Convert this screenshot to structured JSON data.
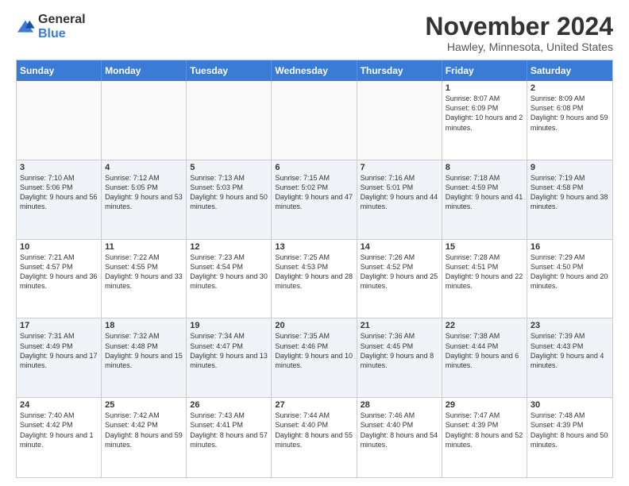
{
  "header": {
    "logo_general": "General",
    "logo_blue": "Blue",
    "main_title": "November 2024",
    "subtitle": "Hawley, Minnesota, United States"
  },
  "calendar": {
    "days_of_week": [
      "Sunday",
      "Monday",
      "Tuesday",
      "Wednesday",
      "Thursday",
      "Friday",
      "Saturday"
    ],
    "weeks": [
      {
        "alt": false,
        "cells": [
          {
            "day": "",
            "info": ""
          },
          {
            "day": "",
            "info": ""
          },
          {
            "day": "",
            "info": ""
          },
          {
            "day": "",
            "info": ""
          },
          {
            "day": "",
            "info": ""
          },
          {
            "day": "1",
            "info": "Sunrise: 8:07 AM\nSunset: 6:09 PM\nDaylight: 10 hours and 2 minutes."
          },
          {
            "day": "2",
            "info": "Sunrise: 8:09 AM\nSunset: 6:08 PM\nDaylight: 9 hours and 59 minutes."
          }
        ]
      },
      {
        "alt": true,
        "cells": [
          {
            "day": "3",
            "info": "Sunrise: 7:10 AM\nSunset: 5:06 PM\nDaylight: 9 hours and 56 minutes."
          },
          {
            "day": "4",
            "info": "Sunrise: 7:12 AM\nSunset: 5:05 PM\nDaylight: 9 hours and 53 minutes."
          },
          {
            "day": "5",
            "info": "Sunrise: 7:13 AM\nSunset: 5:03 PM\nDaylight: 9 hours and 50 minutes."
          },
          {
            "day": "6",
            "info": "Sunrise: 7:15 AM\nSunset: 5:02 PM\nDaylight: 9 hours and 47 minutes."
          },
          {
            "day": "7",
            "info": "Sunrise: 7:16 AM\nSunset: 5:01 PM\nDaylight: 9 hours and 44 minutes."
          },
          {
            "day": "8",
            "info": "Sunrise: 7:18 AM\nSunset: 4:59 PM\nDaylight: 9 hours and 41 minutes."
          },
          {
            "day": "9",
            "info": "Sunrise: 7:19 AM\nSunset: 4:58 PM\nDaylight: 9 hours and 38 minutes."
          }
        ]
      },
      {
        "alt": false,
        "cells": [
          {
            "day": "10",
            "info": "Sunrise: 7:21 AM\nSunset: 4:57 PM\nDaylight: 9 hours and 36 minutes."
          },
          {
            "day": "11",
            "info": "Sunrise: 7:22 AM\nSunset: 4:55 PM\nDaylight: 9 hours and 33 minutes."
          },
          {
            "day": "12",
            "info": "Sunrise: 7:23 AM\nSunset: 4:54 PM\nDaylight: 9 hours and 30 minutes."
          },
          {
            "day": "13",
            "info": "Sunrise: 7:25 AM\nSunset: 4:53 PM\nDaylight: 9 hours and 28 minutes."
          },
          {
            "day": "14",
            "info": "Sunrise: 7:26 AM\nSunset: 4:52 PM\nDaylight: 9 hours and 25 minutes."
          },
          {
            "day": "15",
            "info": "Sunrise: 7:28 AM\nSunset: 4:51 PM\nDaylight: 9 hours and 22 minutes."
          },
          {
            "day": "16",
            "info": "Sunrise: 7:29 AM\nSunset: 4:50 PM\nDaylight: 9 hours and 20 minutes."
          }
        ]
      },
      {
        "alt": true,
        "cells": [
          {
            "day": "17",
            "info": "Sunrise: 7:31 AM\nSunset: 4:49 PM\nDaylight: 9 hours and 17 minutes."
          },
          {
            "day": "18",
            "info": "Sunrise: 7:32 AM\nSunset: 4:48 PM\nDaylight: 9 hours and 15 minutes."
          },
          {
            "day": "19",
            "info": "Sunrise: 7:34 AM\nSunset: 4:47 PM\nDaylight: 9 hours and 13 minutes."
          },
          {
            "day": "20",
            "info": "Sunrise: 7:35 AM\nSunset: 4:46 PM\nDaylight: 9 hours and 10 minutes."
          },
          {
            "day": "21",
            "info": "Sunrise: 7:36 AM\nSunset: 4:45 PM\nDaylight: 9 hours and 8 minutes."
          },
          {
            "day": "22",
            "info": "Sunrise: 7:38 AM\nSunset: 4:44 PM\nDaylight: 9 hours and 6 minutes."
          },
          {
            "day": "23",
            "info": "Sunrise: 7:39 AM\nSunset: 4:43 PM\nDaylight: 9 hours and 4 minutes."
          }
        ]
      },
      {
        "alt": false,
        "cells": [
          {
            "day": "24",
            "info": "Sunrise: 7:40 AM\nSunset: 4:42 PM\nDaylight: 9 hours and 1 minute."
          },
          {
            "day": "25",
            "info": "Sunrise: 7:42 AM\nSunset: 4:42 PM\nDaylight: 8 hours and 59 minutes."
          },
          {
            "day": "26",
            "info": "Sunrise: 7:43 AM\nSunset: 4:41 PM\nDaylight: 8 hours and 57 minutes."
          },
          {
            "day": "27",
            "info": "Sunrise: 7:44 AM\nSunset: 4:40 PM\nDaylight: 8 hours and 55 minutes."
          },
          {
            "day": "28",
            "info": "Sunrise: 7:46 AM\nSunset: 4:40 PM\nDaylight: 8 hours and 54 minutes."
          },
          {
            "day": "29",
            "info": "Sunrise: 7:47 AM\nSunset: 4:39 PM\nDaylight: 8 hours and 52 minutes."
          },
          {
            "day": "30",
            "info": "Sunrise: 7:48 AM\nSunset: 4:39 PM\nDaylight: 8 hours and 50 minutes."
          }
        ]
      }
    ]
  }
}
